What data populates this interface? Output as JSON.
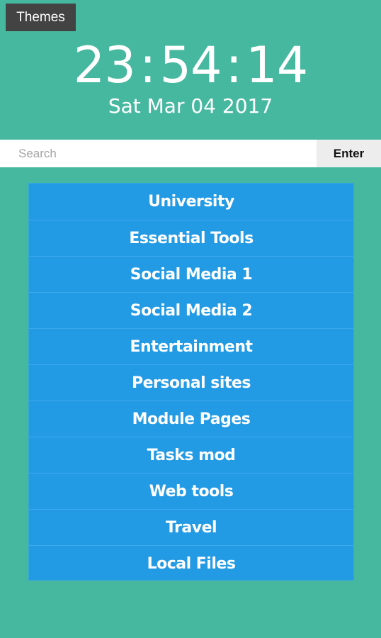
{
  "header": {
    "themes_label": "Themes"
  },
  "clock": {
    "hours": "23",
    "minutes": "54",
    "seconds": "14",
    "separator": ":",
    "date": "Sat Mar 04 2017"
  },
  "search": {
    "placeholder": "Search",
    "value": "",
    "enter_label": "Enter"
  },
  "menu": {
    "items": [
      {
        "label": "University"
      },
      {
        "label": "Essential Tools"
      },
      {
        "label": "Social Media 1"
      },
      {
        "label": "Social Media 2"
      },
      {
        "label": "Entertainment"
      },
      {
        "label": "Personal sites"
      },
      {
        "label": "Module Pages"
      },
      {
        "label": "Tasks mod"
      },
      {
        "label": "Web tools"
      },
      {
        "label": "Travel"
      },
      {
        "label": "Local Files"
      }
    ]
  },
  "colors": {
    "background": "#47b8a0",
    "menu_background": "#239ae4",
    "themes_button": "#434343",
    "enter_button": "#ededed"
  }
}
